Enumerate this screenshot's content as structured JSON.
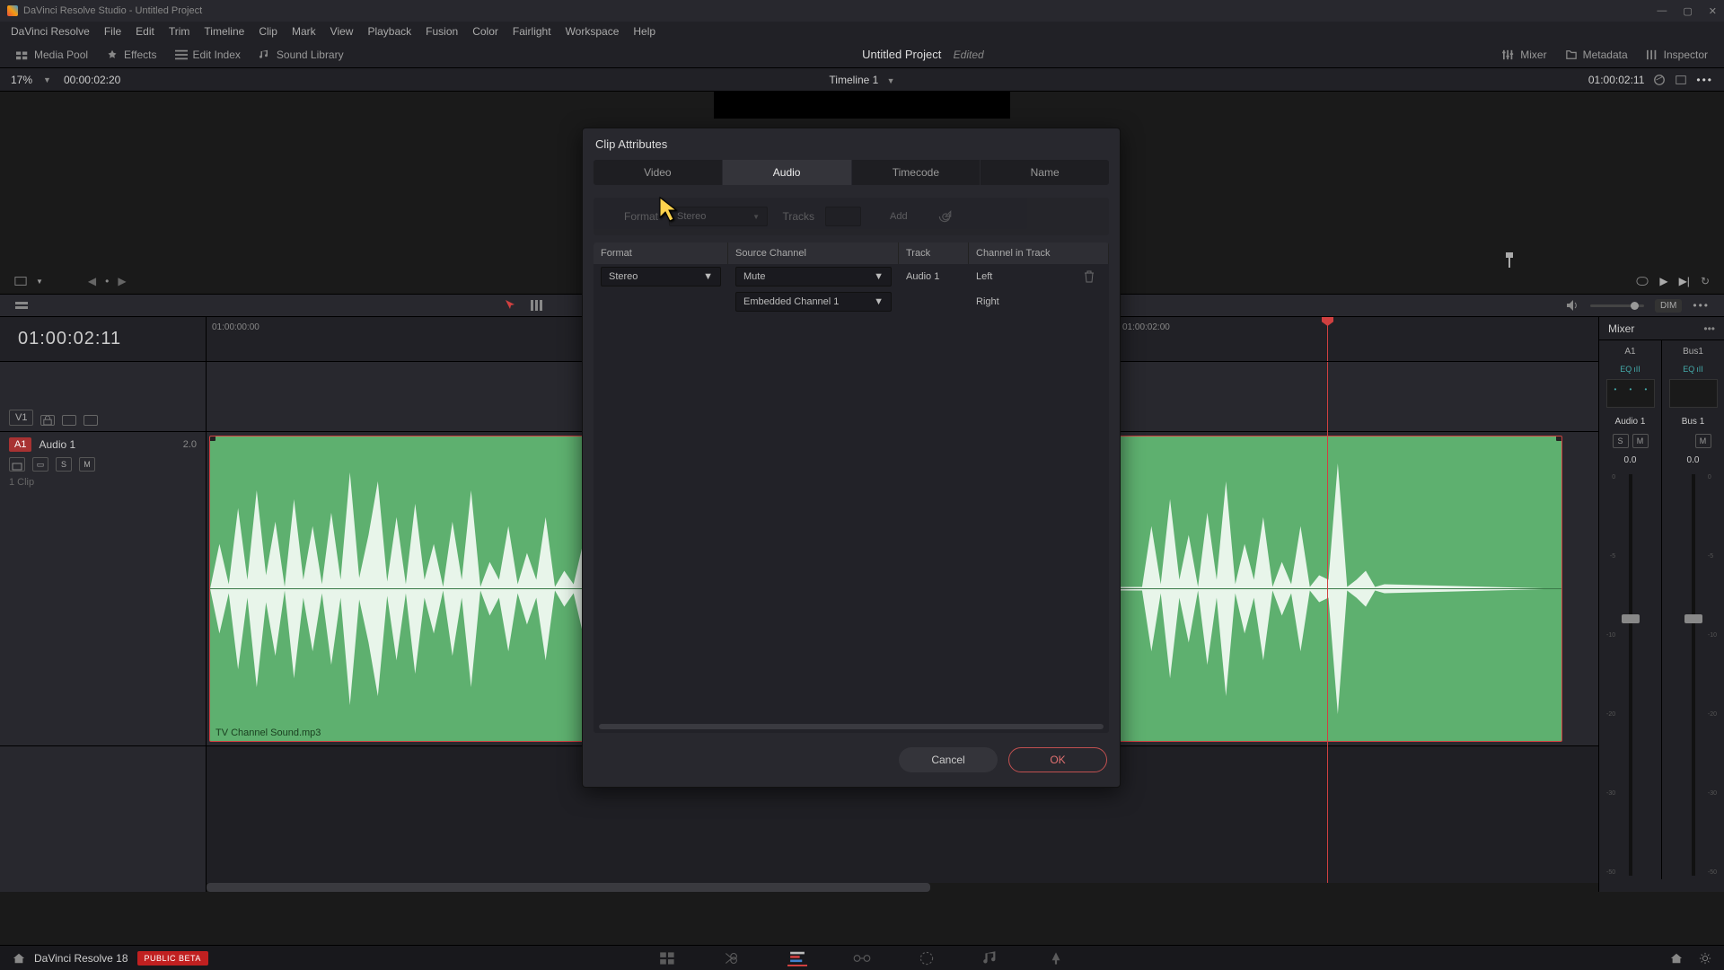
{
  "titlebar": {
    "app": "DaVinci Resolve Studio",
    "doc": "Untitled Project"
  },
  "menu": [
    "DaVinci Resolve",
    "File",
    "Edit",
    "Trim",
    "Timeline",
    "Clip",
    "Mark",
    "View",
    "Playback",
    "Fusion",
    "Color",
    "Fairlight",
    "Workspace",
    "Help"
  ],
  "toolbar": {
    "media_pool": "Media Pool",
    "effects": "Effects",
    "edit_index": "Edit Index",
    "sound_library": "Sound Library",
    "project": "Untitled Project",
    "status": "Edited",
    "mixer": "Mixer",
    "metadata": "Metadata",
    "inspector": "Inspector"
  },
  "tlinfo": {
    "zoom": "17%",
    "tc": "00:00:02:20",
    "timeline": "Timeline 1",
    "right_tc": "01:00:02:11"
  },
  "edit_tools": {
    "dim": "DIM"
  },
  "timeline": {
    "big_tc": "01:00:02:11",
    "ruler": [
      "01:00:00:00",
      "01:00:02:00"
    ],
    "v1": {
      "label": "V1"
    },
    "a1": {
      "badge": "A1",
      "name": "Audio 1",
      "num": "2.0",
      "s": "S",
      "m": "M",
      "clips": "1 Clip"
    },
    "clip_name": "TV Channel Sound.mp3"
  },
  "mixer": {
    "title": "Mixer",
    "cols": [
      {
        "ch": "A1",
        "eq": "EQ",
        "track": "Audio 1",
        "s": "S",
        "m": "M",
        "db": "0.0"
      },
      {
        "ch": "Bus1",
        "eq": "EQ",
        "track": "Bus 1",
        "m": "M",
        "db": "0.0"
      }
    ],
    "scale": [
      "0",
      "-5",
      "-10",
      "-20",
      "-30",
      "-50"
    ]
  },
  "bottom": {
    "app": "DaVinci Resolve 18",
    "badge": "PUBLIC BETA"
  },
  "dialog": {
    "title": "Clip Attributes",
    "tabs": [
      "Video",
      "Audio",
      "Timecode",
      "Name"
    ],
    "active_tab": 1,
    "sec1": {
      "format_label": "Format",
      "format_val": "Stereo",
      "tracks_label": "Tracks",
      "add": "Add"
    },
    "headers": [
      "Format",
      "Source Channel",
      "Track",
      "Channel in Track"
    ],
    "row": {
      "format": "Stereo",
      "sc1": "Mute",
      "sc2": "Embedded Channel 1",
      "track": "Audio 1",
      "ch1": "Left",
      "ch2": "Right"
    },
    "cancel": "Cancel",
    "ok": "OK"
  }
}
